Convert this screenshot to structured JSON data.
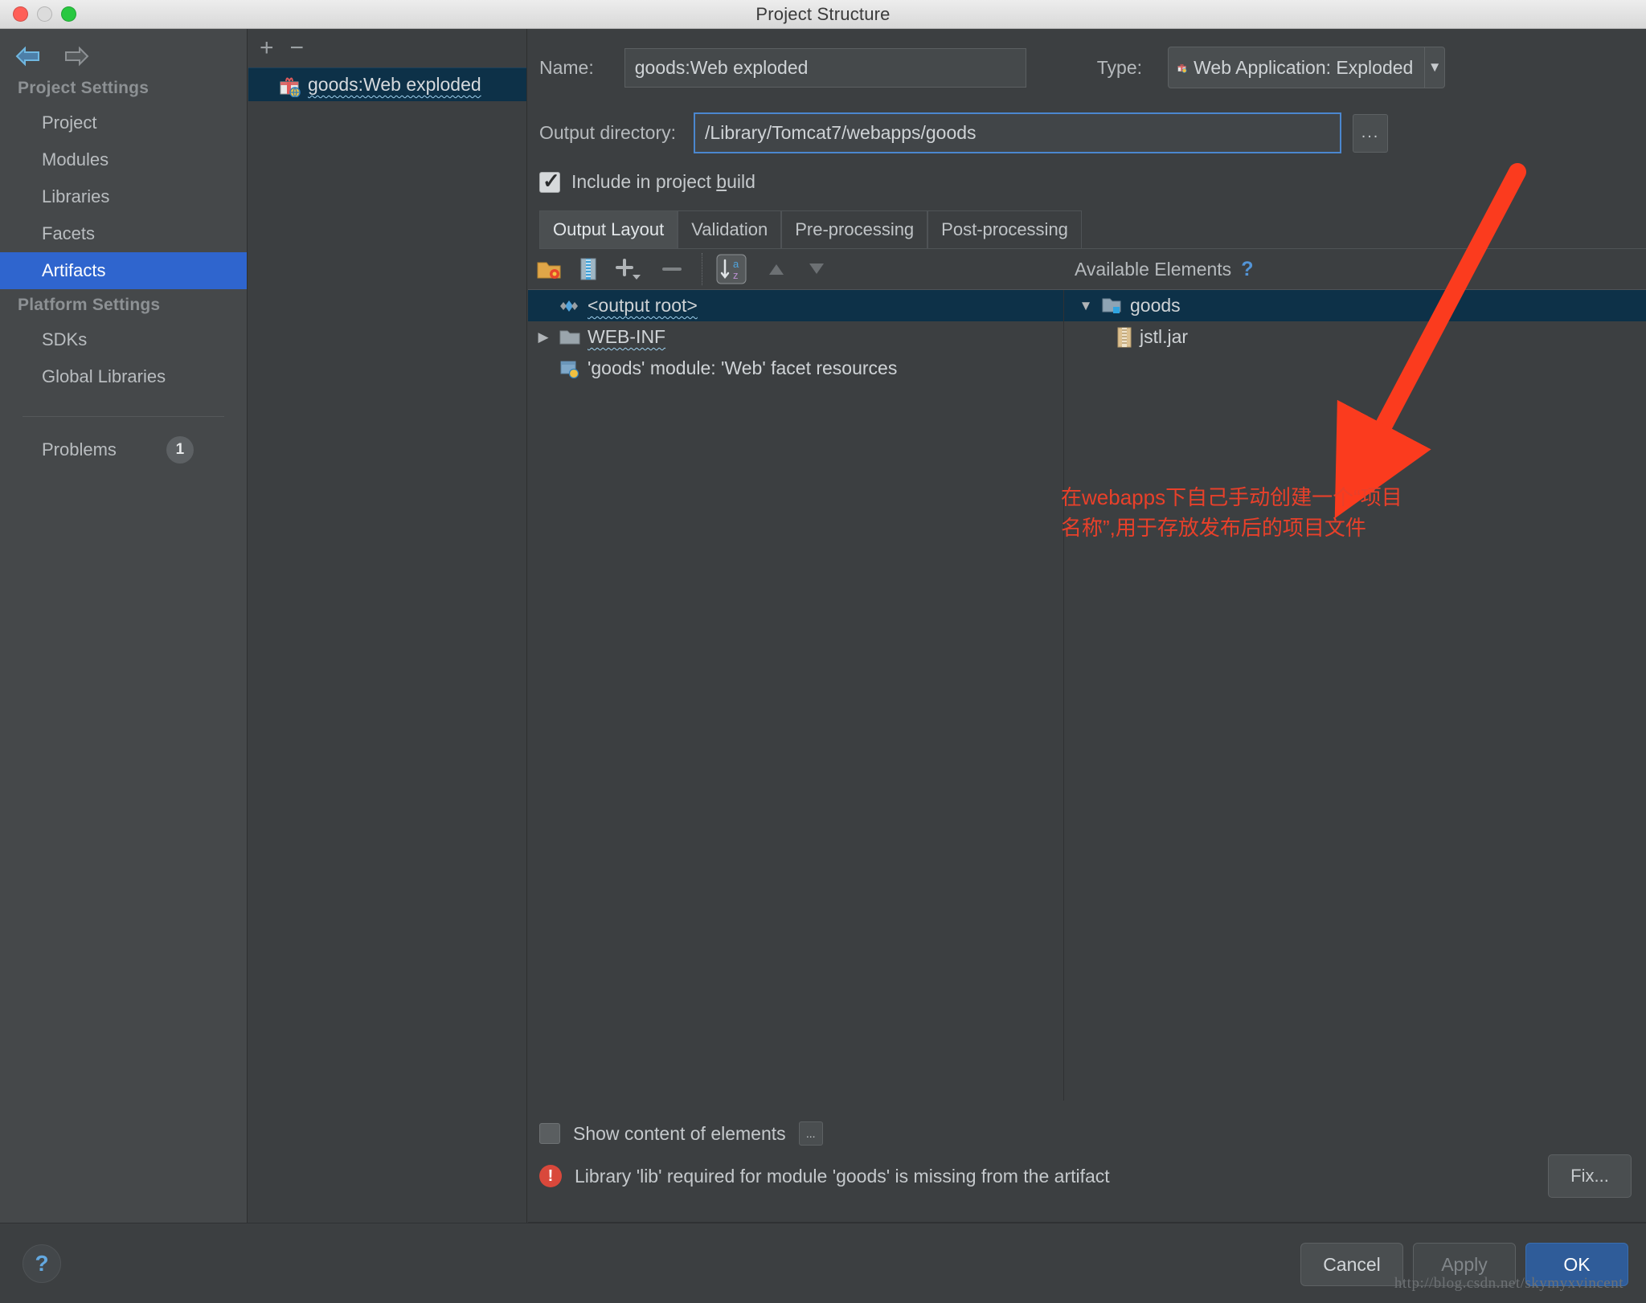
{
  "window": {
    "title": "Project Structure"
  },
  "nav": {
    "back": "back-arrow",
    "forward": "forward-arrow"
  },
  "sidebar": {
    "groups": [
      {
        "label": "Project Settings",
        "items": [
          "Project",
          "Modules",
          "Libraries",
          "Facets",
          "Artifacts"
        ]
      },
      {
        "label": "Platform Settings",
        "items": [
          "SDKs",
          "Global Libraries"
        ]
      }
    ],
    "selected": "Artifacts",
    "problems": {
      "label": "Problems",
      "count": "1"
    }
  },
  "artifact_list": {
    "add_label": "+",
    "remove_label": "−",
    "items": [
      {
        "label": "goods:Web exploded",
        "icon": "artifact-gift-icon",
        "selected": true
      }
    ]
  },
  "detail": {
    "name_label": "Name:",
    "name_value": "goods:Web exploded",
    "type_label": "Type:",
    "type_value": "Web Application: Exploded",
    "output_label": "Output directory:",
    "output_value": "/Library/Tomcat7/webapps/goods",
    "browse_label": "...",
    "include_checkbox": {
      "checked": true,
      "text_before": "Include in project ",
      "accel": "b",
      "text_after": "uild"
    },
    "tabs": [
      {
        "label": "Output Layout",
        "active": true
      },
      {
        "label": "Validation",
        "active": false
      },
      {
        "label": "Pre-processing",
        "active": false
      },
      {
        "label": "Post-processing",
        "active": false
      }
    ],
    "layout_toolbar": [
      "new-directory-icon",
      "create-archive-icon",
      "add-copy-icon",
      "remove-icon",
      "sort-alphabetically-icon",
      "move-up-icon",
      "move-down-icon"
    ],
    "available_elements_label": "Available Elements",
    "help_hint": "?",
    "output_tree": [
      {
        "label": "<output root>",
        "icon": "output-root-icon",
        "depth": 0,
        "selected": true,
        "wavy": true,
        "caret": ""
      },
      {
        "label": "WEB-INF",
        "icon": "folder-icon",
        "depth": 0,
        "selected": false,
        "wavy": true,
        "caret": "▶"
      },
      {
        "label": "'goods' module: 'Web' facet resources",
        "icon": "facet-resources-icon",
        "depth": 1,
        "selected": false,
        "wavy": false,
        "caret": ""
      }
    ],
    "available_tree": [
      {
        "label": "goods",
        "icon": "module-folder-icon",
        "depth": 0,
        "selected": true,
        "caret": "▼"
      },
      {
        "label": "jstl.jar",
        "icon": "jar-icon",
        "depth": 1,
        "selected": false,
        "caret": ""
      }
    ],
    "show_content": {
      "label": "Show content of elements",
      "checked": false,
      "dots": "..."
    },
    "error": {
      "icon": "error-icon",
      "message": "Library 'lib' required for module 'goods' is missing from the artifact",
      "fix_label": "Fix..."
    }
  },
  "footer": {
    "help": "?",
    "buttons": [
      {
        "label": "Cancel",
        "style": "normal"
      },
      {
        "label": "Apply",
        "style": "disabled"
      },
      {
        "label": "OK",
        "style": "primary"
      }
    ],
    "watermark": "http://blog.csdn.net/skymyxvincent"
  },
  "annotation": {
    "line1": "在webapps下自己手动创建一个“项目",
    "line2": "名称”,用于存放发布后的项目文件",
    "color": "#e8402a"
  },
  "colors": {
    "accent_blue": "#2f65ce",
    "tree_selection": "#0d3148",
    "background": "#3c3f41",
    "sidebar_bg": "#45484a",
    "annotation_red": "#e8402a",
    "error_red": "#d9483b"
  }
}
